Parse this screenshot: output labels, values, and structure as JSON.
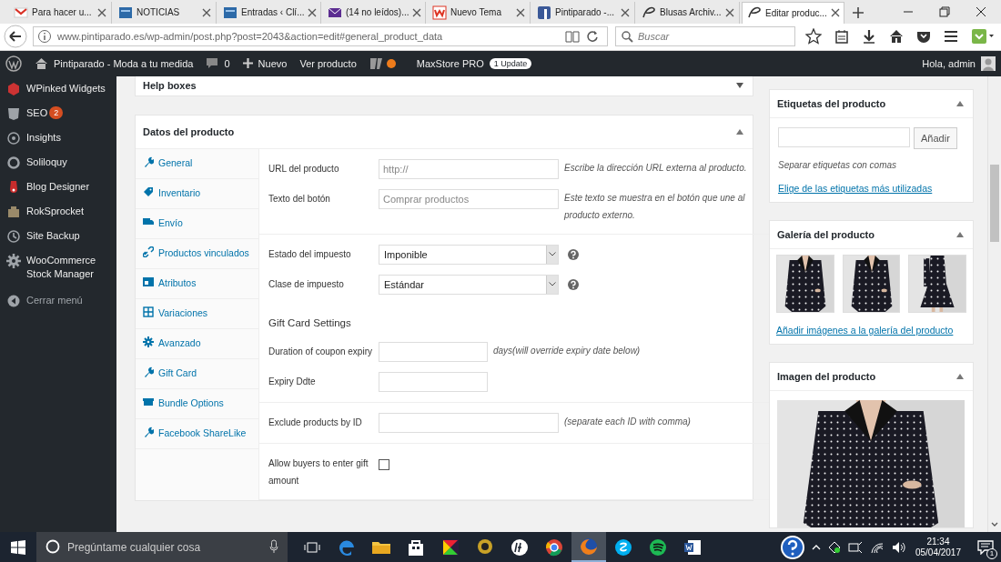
{
  "browser": {
    "tabs": [
      {
        "title": "Para hacer u...",
        "selected": false
      },
      {
        "title": "NOTICIAS",
        "selected": false
      },
      {
        "title": "Entradas ‹ Clí...",
        "selected": false
      },
      {
        "title": "(14 no leídos)...",
        "selected": false
      },
      {
        "title": "Nuevo Tema",
        "selected": false
      },
      {
        "title": "Pintiparado -...",
        "selected": false
      },
      {
        "title": "Blusas Archiv...",
        "selected": false
      },
      {
        "title": "Editar produc...",
        "selected": true
      }
    ],
    "address": "www.pintiparado.es/wp-admin/post.php?post=2043&action=edit#general_product_data",
    "search": {
      "placeholder": "Buscar"
    }
  },
  "admin_bar": {
    "site": "Pintiparado - Moda a tu medida",
    "comments": "0",
    "new": "Nuevo",
    "view": "Ver producto",
    "plugin": "MaxStore PRO",
    "plugin_badge": "1 Update",
    "greeting": "Hola, admin"
  },
  "admin_menu": [
    {
      "label": "WPinked Widgets",
      "kind": "link"
    },
    {
      "label": "SEO",
      "badge": "2",
      "kind": "link"
    },
    {
      "label": "Insights",
      "kind": "link"
    },
    {
      "label": "Soliloquy",
      "kind": "link"
    },
    {
      "label": "Blog Designer",
      "kind": "link"
    },
    {
      "label": "RokSprocket",
      "kind": "link"
    },
    {
      "label": "Site Backup",
      "kind": "link"
    },
    {
      "label": "WooCommerce Stock Manager",
      "kind": "link"
    },
    {
      "label": "Cerrar menú",
      "kind": "collapse"
    }
  ],
  "help_boxes": {
    "title": "Help boxes"
  },
  "product_data": {
    "title": "Datos del producto",
    "tabs": [
      "General",
      "Inventario",
      "Envío",
      "Productos vinculados",
      "Atributos",
      "Variaciones",
      "Avanzado",
      "Gift Card",
      "Bundle Options",
      "Facebook ShareLike"
    ],
    "sections": [
      [
        {
          "kind": "text",
          "label": "URL del producto",
          "placeholder": "http://",
          "description": "Escribe la dirección URL externa al producto."
        },
        {
          "kind": "text",
          "label": "Texto del botón",
          "placeholder": "Comprar productos",
          "description": "Este texto se muestra en el botón que une al producto externo."
        }
      ],
      [
        {
          "kind": "select",
          "label": "Estado del impuesto",
          "value": "Imponible"
        },
        {
          "kind": "select",
          "label": "Clase de impuesto",
          "value": "Estándar"
        },
        {
          "kind": "heading",
          "label": "Gift Card Settings"
        },
        {
          "kind": "short",
          "label": "Duration of coupon expiry",
          "description": "days(will override expiry date below)"
        },
        {
          "kind": "short",
          "label": "Expiry Ddte"
        }
      ],
      [
        {
          "kind": "text",
          "label": "Exclude products by ID",
          "description": "(separate each ID with comma)"
        }
      ],
      [
        {
          "kind": "checkbox",
          "label": "Allow buyers to enter gift amount",
          "checked": false
        }
      ]
    ]
  },
  "tags_box": {
    "title": "Etiquetas del producto",
    "button": "Añadir",
    "hint": "Separar etiquetas con comas",
    "link": "Elige de las etiquetas más utilizadas"
  },
  "gallery_box": {
    "title": "Galería del producto",
    "link": "Añadir imágenes a la galería del producto"
  },
  "image_box": {
    "title": "Imagen del producto"
  },
  "taskbar": {
    "search_placeholder": "Pregúntame cualquier cosa",
    "apps": [
      {
        "selected": false
      },
      {
        "selected": false
      },
      {
        "selected": false
      },
      {
        "selected": false
      },
      {
        "selected": false
      },
      {
        "selected": false
      },
      {
        "selected": false
      },
      {
        "selected": true
      },
      {
        "selected": false
      },
      {
        "selected": false
      },
      {
        "selected": false
      }
    ],
    "time": "21:34",
    "date": "05/04/2017",
    "notifications": "1"
  }
}
